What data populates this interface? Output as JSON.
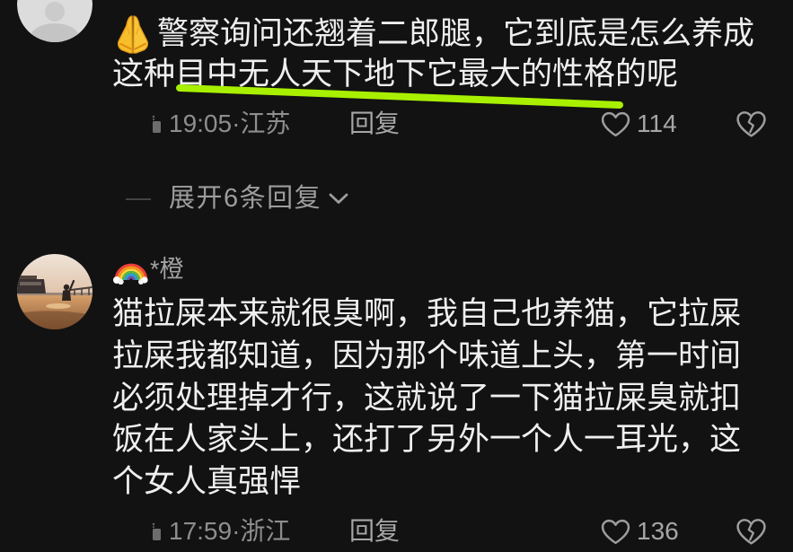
{
  "colors": {
    "background": "#121212",
    "text": "#efefef",
    "meta": "#8e8e8e",
    "meta_strong": "#a6a6a6",
    "highlight": "#a8f000"
  },
  "labels": {
    "reply": "回复",
    "meta_separator": "·"
  },
  "icons": {
    "like": "heart-outline-icon",
    "dislike": "broken-heart-icon",
    "expand": "chevron-down-icon",
    "meta_marker": "meta-marker-icon"
  },
  "comments": [
    {
      "lead_icon": "folded-hands-icon",
      "text_lines": [
        "警察询问还翘着二郎腿，它到底是怎么养成",
        "这种目中无人天下地下它最大的性格的呢"
      ],
      "time": "19:05",
      "location": "江苏",
      "likes": 114
    },
    {
      "username_icon": "rainbow-icon",
      "username": "*橙",
      "text_lines": [
        "猫拉屎本来就很臭啊，我自己也养猫，它拉屎",
        "拉屎我都知道，因为那个味道上头，第一时间",
        "必须处理掉才行，这就说了一下猫拉屎臭就扣",
        "饭在人家头上，还打了另外一个人一耳光，这",
        "个女人真强悍"
      ],
      "time": "17:59",
      "location": "浙江",
      "likes": 136
    }
  ],
  "expand_replies": {
    "label": "展开6条回复"
  }
}
